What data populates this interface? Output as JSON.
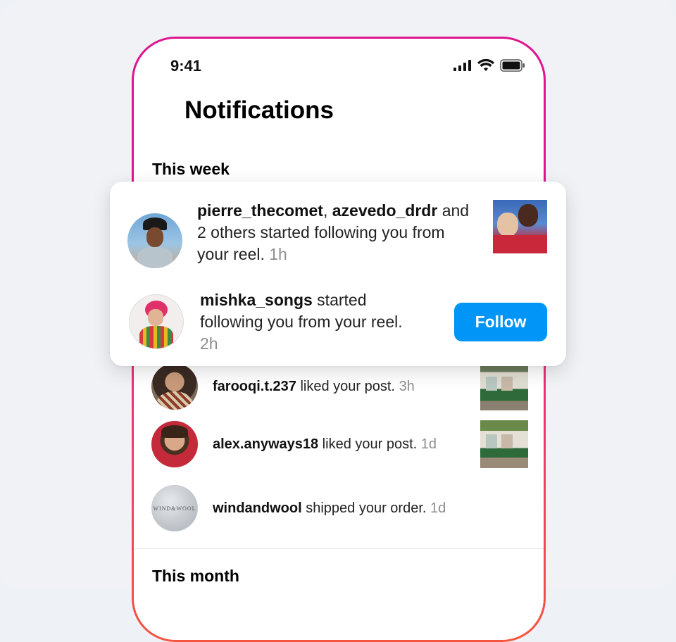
{
  "status_bar": {
    "time": "9:41"
  },
  "header": {
    "title": "Notifications"
  },
  "sections": {
    "this_week": "This week",
    "this_month": "This month"
  },
  "popup": {
    "item1": {
      "user1": "pierre_thecomet",
      "separator": ", ",
      "user2": "azevedo_drdr",
      "message": " and 2 others started following you from your reel.",
      "time": "1h"
    },
    "item2": {
      "user": "mishka_songs",
      "message": " started following you from your reel.",
      "time": "2h",
      "follow_label": "Follow"
    }
  },
  "notifications": [
    {
      "user": "farooqi.t.237",
      "message": " liked your post.",
      "time": "3h"
    },
    {
      "user": "alex.anyways18",
      "message": " liked your post.",
      "time": "1d"
    },
    {
      "user": "windandwool",
      "message": " shipped your order.",
      "time": "1d",
      "avatar_text": "WIND&WOOL"
    }
  ],
  "colors": {
    "accent": "#0095f6",
    "frame_top": "#e0148f",
    "frame_bottom": "#f5553e",
    "muted": "#8e8e8e"
  }
}
